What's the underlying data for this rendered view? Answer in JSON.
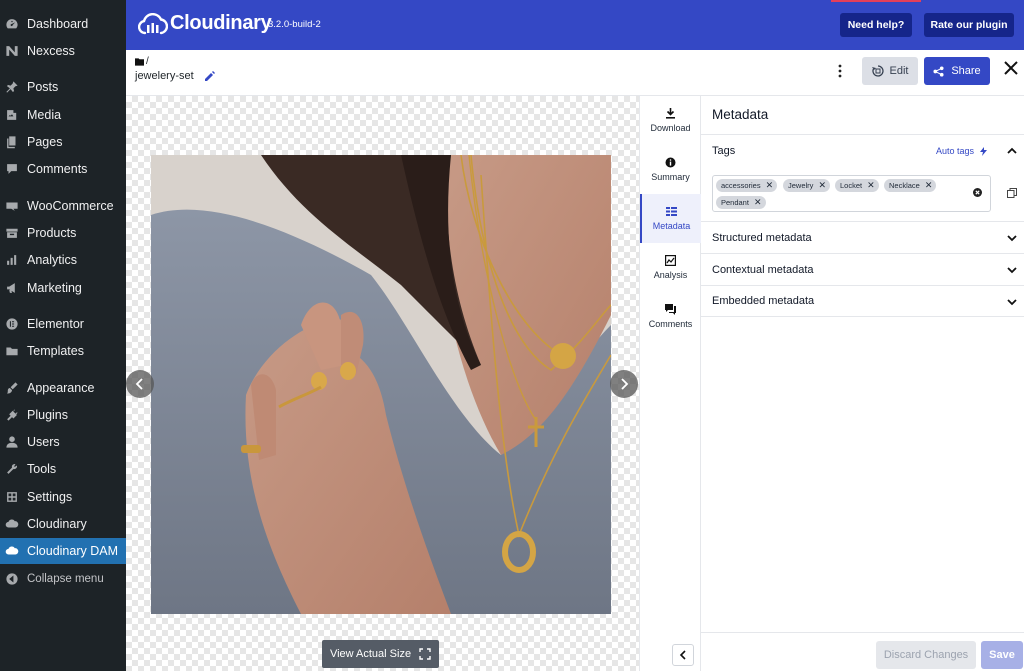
{
  "wp_menu": [
    {
      "label": "Dashboard",
      "icon": "dashboard-icon"
    },
    {
      "label": "Nexcess",
      "icon": "nexcess-icon"
    },
    {
      "label": "Posts",
      "icon": "pin-icon"
    },
    {
      "label": "Media",
      "icon": "media-icon"
    },
    {
      "label": "Pages",
      "icon": "pages-icon"
    },
    {
      "label": "Comments",
      "icon": "comment-icon"
    },
    {
      "label": "WooCommerce",
      "icon": "woo-icon"
    },
    {
      "label": "Products",
      "icon": "products-icon"
    },
    {
      "label": "Analytics",
      "icon": "analytics-icon"
    },
    {
      "label": "Marketing",
      "icon": "megaphone-icon"
    },
    {
      "label": "Elementor",
      "icon": "elementor-icon"
    },
    {
      "label": "Templates",
      "icon": "folder-icon"
    },
    {
      "label": "Appearance",
      "icon": "brush-icon"
    },
    {
      "label": "Plugins",
      "icon": "plug-icon"
    },
    {
      "label": "Users",
      "icon": "user-icon"
    },
    {
      "label": "Tools",
      "icon": "wrench-icon"
    },
    {
      "label": "Settings",
      "icon": "settings-icon"
    },
    {
      "label": "Cloudinary",
      "icon": "cloud-icon"
    },
    {
      "label": "Cloudinary DAM",
      "icon": "cloud-icon",
      "active": true
    },
    {
      "label": "Collapse menu",
      "icon": "collapse-icon"
    }
  ],
  "topbar": {
    "brand": "Cloudinary",
    "version": "3.2.0-build-2",
    "help_label": "Need help?",
    "rate_label": "Rate our plugin"
  },
  "header": {
    "breadcrumb": "/",
    "asset_name": "jewelery-set",
    "edit_label": "Edit",
    "share_label": "Share"
  },
  "viewer": {
    "view_actual_label": "View Actual Size"
  },
  "rail": [
    {
      "label": "Download",
      "icon": "download-icon"
    },
    {
      "label": "Summary",
      "icon": "info-icon"
    },
    {
      "label": "Metadata",
      "icon": "metadata-icon",
      "active": true
    },
    {
      "label": "Analysis",
      "icon": "analysis-icon"
    },
    {
      "label": "Comments",
      "icon": "comments-icon"
    }
  ],
  "panel": {
    "title": "Metadata",
    "tags_label": "Tags",
    "auto_tags_label": "Auto tags",
    "tags": [
      "accessories",
      "Jewelry",
      "Locket",
      "Necklace",
      "Pendant"
    ],
    "sections": [
      "Structured metadata",
      "Contextual metadata",
      "Embedded metadata"
    ],
    "discard_label": "Discard Changes",
    "save_label": "Save"
  },
  "colors": {
    "brand_blue": "#3448c5",
    "wp_dark": "#1d2327",
    "wp_active": "#2271b1"
  }
}
